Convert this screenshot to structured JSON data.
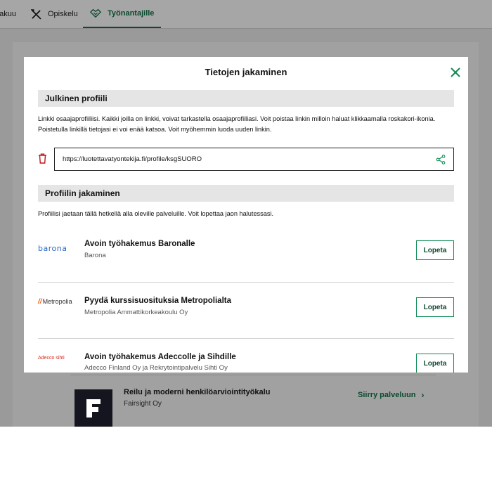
{
  "colors": {
    "accent": "#0e8a53",
    "accent_dark": "#0b4a2e",
    "danger": "#c0161b",
    "section_bg": "#e5e5e5"
  },
  "nav": {
    "items": [
      {
        "label": "hakuu",
        "icon": "search-icon"
      },
      {
        "label": "Opiskelu",
        "icon": "tools-icon"
      },
      {
        "label": "Työnantajille",
        "icon": "handshake-icon",
        "active": true
      }
    ]
  },
  "background": {
    "service": {
      "title": "Reilu ja moderni henkilöarviointityökalu",
      "org": "Fairsight Oy",
      "link": "Siirry palveluun",
      "logo_letter": "F"
    }
  },
  "modal": {
    "title": "Tietojen jakaminen",
    "public_profile": {
      "heading": "Julkinen profiili",
      "description": "Linkki osaajaprofiiliisi. Kaikki joilla on linkki, voivat tarkastella osaajaprofiiliasi. Voit poistaa linkin milloin haluat klikkaamalla roskakori-ikonia. Poistetulla linkillä tietojasi ei voi enää katsoa. Voit myöhemmin luoda uuden linkin.",
      "link_value": "https://luotettavatyontekija.fi/profile/ksgSUORO"
    },
    "sharing": {
      "heading": "Profiilin jakaminen",
      "description": "Profiilisi jaetaan tällä hetkellä alla oleville palveluille. Voit lopettaa jaon halutessasi.",
      "services": [
        {
          "logo": "barona",
          "title": "Avoin työhakemus Baronalle",
          "org": "Barona",
          "button": "Lopeta"
        },
        {
          "logo": "Metropolia",
          "title": "Pyydä kurssisuosituksia Metropolialta",
          "org": "Metropolia Ammattikorkeakoulu Oy",
          "button": "Lopeta"
        },
        {
          "logo": "Adecco sihti",
          "title": "Avoin työhakemus Adeccolle ja Sihdille",
          "org": "Adecco Finland Oy ja Rekrytointipalvelu Sihti Oy",
          "button": "Lopeta"
        }
      ]
    }
  }
}
